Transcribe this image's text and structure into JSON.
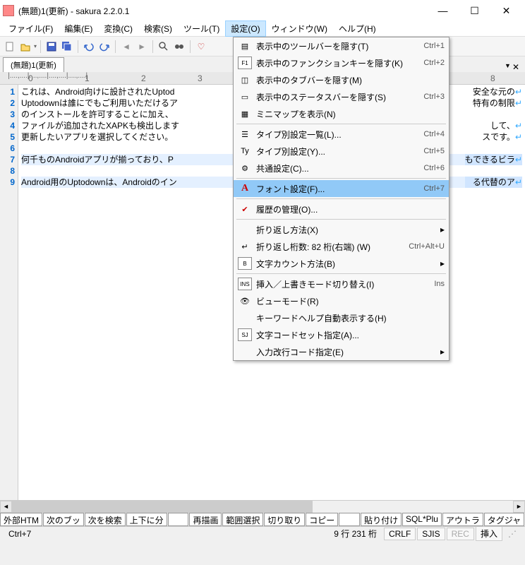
{
  "title": "(無題)1(更新) - sakura 2.2.0.1",
  "menubar": [
    "ファイル(F)",
    "編集(E)",
    "変換(C)",
    "検索(S)",
    "ツール(T)",
    "設定(O)",
    "ウィンドウ(W)",
    "ヘルプ(H)"
  ],
  "menubar_open_index": 5,
  "tab": "(無題)1(更新)",
  "ruler_marks": [
    {
      "pos": 40,
      "label": "0"
    },
    {
      "pos": 120,
      "label": "1"
    },
    {
      "pos": 200,
      "label": "2"
    },
    {
      "pos": 280,
      "label": "3"
    },
    {
      "pos": 695,
      "label": "8"
    }
  ],
  "gutter_lines": [
    "1",
    "2",
    "3",
    "4",
    "5",
    "6",
    "7",
    "8",
    "9"
  ],
  "text_lines": [
    "これは、Android向けに設計されたUptod",
    "Uptodownは誰にでもご利用いただけるア",
    "のインストールを許可することに加え、",
    "ファイルが追加されたXAPKも検出します",
    "更新したいアプリを選択してください。",
    "",
    "何千ものAndroidアプリが揃っており、P",
    "",
    "Android用のUptodownは、Androidのイン"
  ],
  "right_text_fragments": [
    "安全な元の",
    "特有の制限",
    "",
    "して、",
    "スです。",
    "",
    "もできるビラ",
    "",
    "る代替のア"
  ],
  "line_end_glyph": "↵",
  "selected_lines": [
    6,
    8
  ],
  "dropdown": {
    "highlighted": 8,
    "items": [
      {
        "icon": "toolbar",
        "label": "表示中のツールバーを隠す(T)",
        "shortcut": "Ctrl+1"
      },
      {
        "icon": "fkey",
        "label": "表示中のファンクションキーを隠す(K)",
        "shortcut": "Ctrl+2"
      },
      {
        "icon": "tabs",
        "label": "表示中のタブバーを隠す(M)",
        "shortcut": ""
      },
      {
        "icon": "status",
        "label": "表示中のステータスバーを隠す(S)",
        "shortcut": "Ctrl+3"
      },
      {
        "icon": "map",
        "label": "ミニマップを表示(N)",
        "shortcut": ""
      },
      {
        "sep": true
      },
      {
        "icon": "list",
        "label": "タイプ別設定一覧(L)...",
        "shortcut": "Ctrl+4"
      },
      {
        "icon": "type",
        "label": "タイプ別設定(Y)...",
        "shortcut": "Ctrl+5"
      },
      {
        "icon": "common",
        "label": "共通設定(C)...",
        "shortcut": "Ctrl+6"
      },
      {
        "sep": true
      },
      {
        "icon": "font",
        "label": "フォント設定(F)...",
        "shortcut": "Ctrl+7"
      },
      {
        "sep": true
      },
      {
        "icon": "check",
        "label": "履歴の管理(O)...",
        "shortcut": ""
      },
      {
        "sep": true
      },
      {
        "icon": "",
        "label": "折り返し方法(X)",
        "shortcut": "",
        "arrow": true
      },
      {
        "icon": "wrap",
        "label": "折り返し桁数: 82 桁(右端)  (W)",
        "shortcut": "Ctrl+Alt+U"
      },
      {
        "icon": "byte",
        "label": "文字カウント方法(B)",
        "shortcut": "",
        "arrow": true
      },
      {
        "sep": true
      },
      {
        "icon": "ins",
        "label": "挿入／上書きモード切り替え(I)",
        "shortcut": "Ins"
      },
      {
        "icon": "view",
        "label": "ビューモード(R)",
        "shortcut": ""
      },
      {
        "icon": "",
        "label": "キーワードヘルプ自動表示する(H)",
        "shortcut": ""
      },
      {
        "icon": "sj",
        "label": "文字コードセット指定(A)...",
        "shortcut": ""
      },
      {
        "icon": "",
        "label": "入力改行コード指定(E)",
        "shortcut": "",
        "arrow": true
      }
    ]
  },
  "func_keys": [
    "外部HTM",
    "次のブッ",
    "次を検索",
    "上下に分",
    "",
    "再描画",
    "範囲選択",
    "切り取り",
    "コピー",
    "",
    "貼り付け",
    "SQL*Plu",
    "アウトラ",
    "タグジャ"
  ],
  "status": {
    "left": "Ctrl+7",
    "pos": "9 行  231 桁",
    "crlf": "CRLF",
    "enc": "SJIS",
    "rec": "REC",
    "ins": "挿入"
  }
}
